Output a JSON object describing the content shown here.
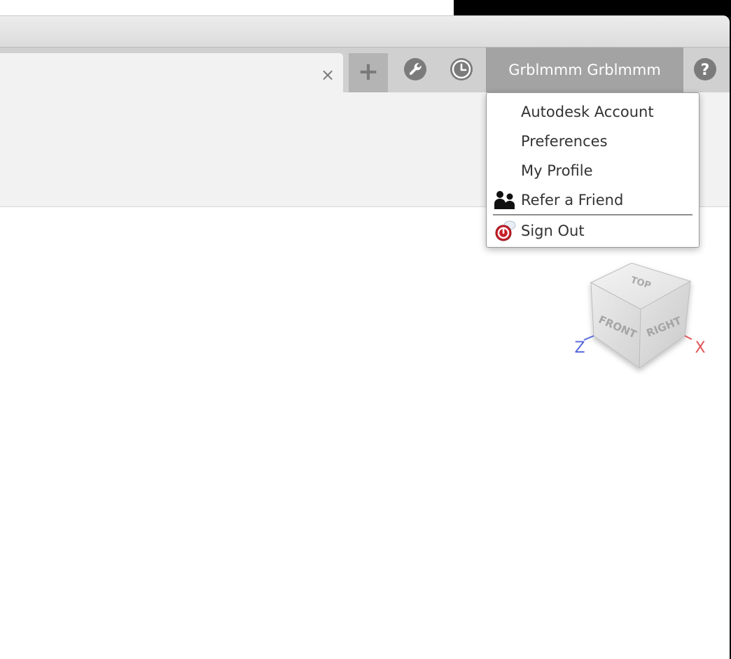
{
  "toolbar": {
    "close_tab_glyph": "×",
    "add_tab_glyph": "+",
    "user_name": "Grblmmm Grblmmm"
  },
  "icons": {
    "close": "close-icon",
    "add": "plus-icon",
    "wrench": "wrench-icon",
    "clock": "clock-icon",
    "help": "help-icon",
    "refer": "people-icon",
    "signout": "power-icon"
  },
  "user_menu": {
    "items": [
      {
        "label": "Autodesk Account"
      },
      {
        "label": "Preferences"
      },
      {
        "label": "My Profile"
      },
      {
        "label": "Refer a Friend"
      },
      {
        "label": "Sign Out"
      }
    ]
  },
  "viewcube": {
    "top": "TOP",
    "front": "FRONT",
    "right": "RIGHT",
    "axis_x": "X",
    "axis_z": "Z"
  },
  "colors": {
    "tab_strip": "#d0d0d0",
    "user_button": "#a3a3a3",
    "axis_x": "#e05555",
    "axis_z": "#5566dd",
    "signout_red": "#c8202a"
  }
}
